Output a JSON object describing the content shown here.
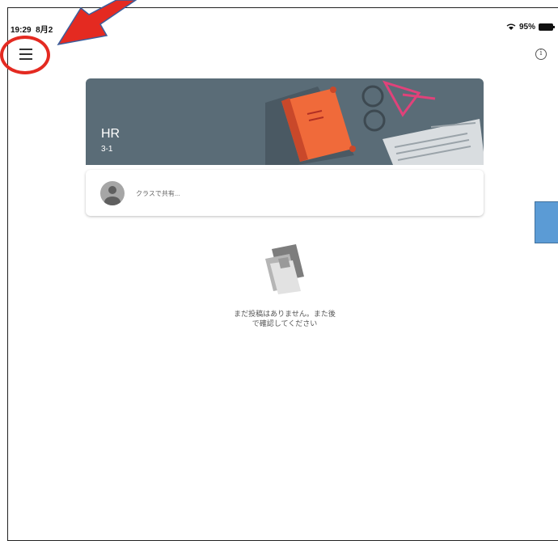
{
  "status_bar": {
    "time": "19:29",
    "date": "8月2",
    "wifi_icon": "wifi-icon",
    "battery_percent": "95%",
    "battery_icon": "battery-icon"
  },
  "toolbar": {
    "menu_icon": "hamburger-menu-icon",
    "info_icon": "info-icon"
  },
  "class_banner": {
    "title": "HR",
    "section": "3-1"
  },
  "share": {
    "placeholder": "クラスで共有..."
  },
  "empty_state": {
    "message": "まだ投稿はありません。また後で確認してください"
  },
  "annotations": {
    "arrow_color": "#e42a21",
    "circle_color": "#e42a21",
    "box_color": "#5b9bd5"
  }
}
